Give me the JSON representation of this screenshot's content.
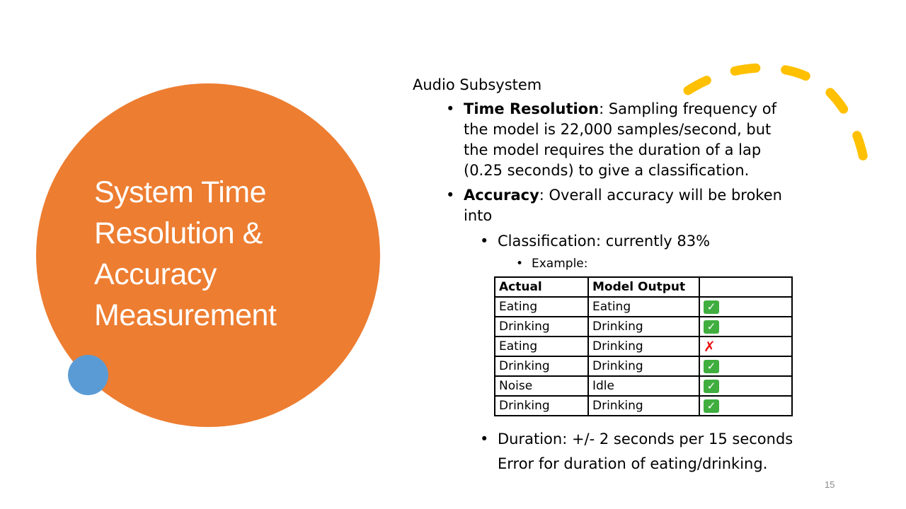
{
  "slide": {
    "title": "System Time Resolution & Accuracy Measurement",
    "page_number": "15",
    "colors": {
      "big_circle": "#ED7D31",
      "small_circle": "#5B9BD5",
      "arc": "#FFC000"
    }
  },
  "content": {
    "heading": "Audio Subsystem",
    "time_resolution": {
      "label": "Time Resolution",
      "text": ": Sampling frequency of the  model is 22,000 samples/second, but the model requires the duration of a lap (0.25 seconds) to give a classification."
    },
    "accuracy": {
      "label": "Accuracy",
      "text": ": Overall accuracy will be broken into"
    },
    "classification": "Classification: currently 83%",
    "example_label": "Example:",
    "duration": "Duration: +/- 2 seconds per 15 seconds Error for duration of eating/drinking."
  },
  "table": {
    "headers": [
      "Actual",
      "Model Output",
      ""
    ],
    "rows": [
      {
        "actual": "Eating",
        "output": "Eating",
        "result": "check-icon"
      },
      {
        "actual": "Drinking",
        "output": "Drinking",
        "result": "check-icon"
      },
      {
        "actual": "Eating",
        "output": "Drinking",
        "result": "cross-icon"
      },
      {
        "actual": "Drinking",
        "output": "Drinking",
        "result": "check-icon"
      },
      {
        "actual": "Noise",
        "output": "Idle",
        "result": "check-icon"
      },
      {
        "actual": "Drinking",
        "output": "Drinking",
        "result": "check-icon"
      }
    ]
  }
}
